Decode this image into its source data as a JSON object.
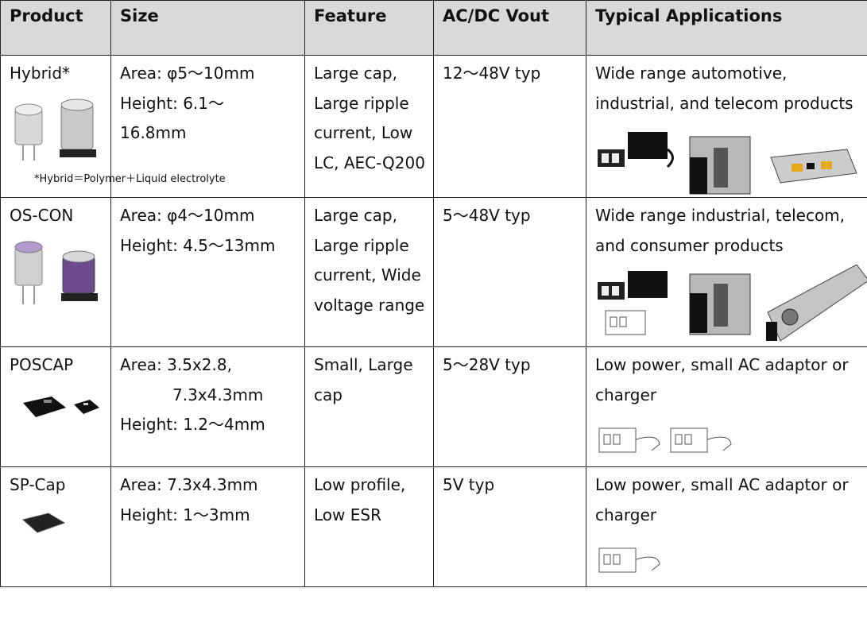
{
  "headers": [
    "Product",
    "Size",
    "Feature",
    "AC/DC Vout",
    "Typical Applications"
  ],
  "rows": [
    {
      "product": "Hybrid*",
      "size": [
        "Area:  φ5～10mm",
        "Height: 6.1～",
        "16.8mm"
      ],
      "feature": [
        "Large cap,",
        "Large ripple",
        "current, Low",
        "LC, AEC-Q200"
      ],
      "vout": "12～48V typ",
      "applications": [
        "Wide range automotive,",
        "industrial, and telecom products"
      ],
      "note": "*Hybrid＝Polymer＋Liquid electrolyte"
    },
    {
      "product": "OS-CON",
      "size": [
        "Area:  φ4～10mm",
        "Height: 4.5～13mm"
      ],
      "feature": [
        "Large cap,",
        "Large ripple",
        "current, Wide",
        "voltage range"
      ],
      "vout": "5～48V typ",
      "applications": [
        "Wide range industrial, telecom,",
        "and consumer products"
      ]
    },
    {
      "product": "POSCAP",
      "size": [
        "Area: 3.5x2.8,",
        "7.3x4.3mm",
        "Height: 1.2～4mm"
      ],
      "feature": [
        "Small, Large",
        "cap"
      ],
      "vout": "5～28V typ",
      "applications": [
        "Low power, small AC adaptor or",
        "charger"
      ]
    },
    {
      "product": "SP-Cap",
      "size": [
        "Area: 7.3x4.3mm",
        "Height: 1～3mm"
      ],
      "feature": [
        "Low profile,",
        "Low ESR"
      ],
      "vout": "5V typ",
      "applications": [
        "Low power, small AC adaptor or",
        "charger"
      ]
    }
  ],
  "product_images": [
    "radial-capacitor-image",
    "radial-capacitor-image",
    "chip-capacitor-image",
    "chip-capacitor-image"
  ],
  "application_images": [
    "power-supply-image",
    "power-supply-image",
    "ac-adaptor-image",
    "ac-adaptor-image"
  ]
}
